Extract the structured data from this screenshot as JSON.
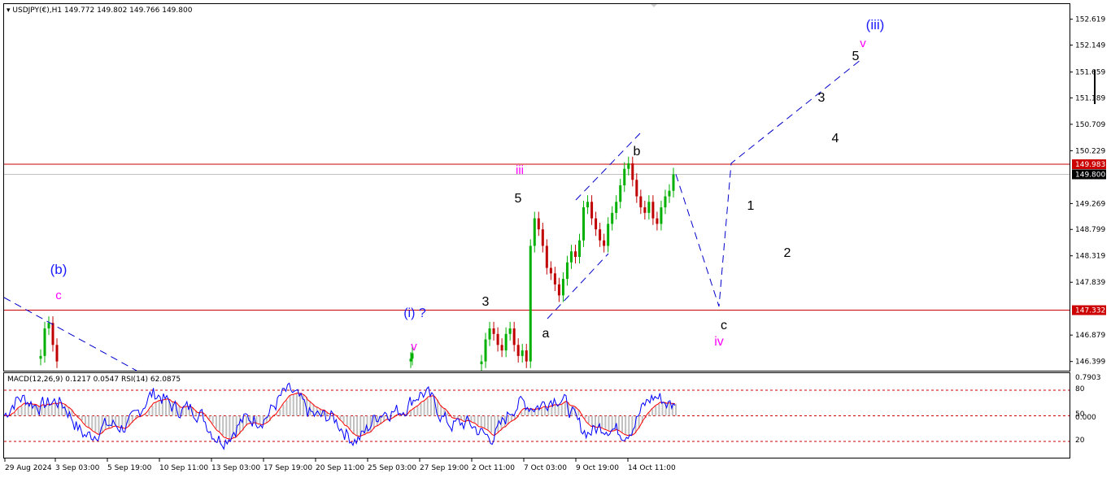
{
  "header": {
    "symbol": "USDJPY(€),H1",
    "ohlc": "149.772 149.802 149.766 149.800"
  },
  "indicator_header": {
    "macd": "MACD(12,26,9) 0.1217 0.0547",
    "rsi": "RSI(14) 62.0875"
  },
  "colors": {
    "up_candle": "#00b000",
    "down_candle": "#c00000",
    "level_line": "#cc0000",
    "wave_blue": "#1a1aff",
    "wave_magenta": "#ff00ff",
    "projection": "#0000cc",
    "price_line": "#c0c0c0",
    "macd_hist": "#c0c0c0",
    "rsi_line": "#0000ff",
    "signal_line": "#ff0000"
  },
  "chart_data": {
    "type": "candlestick",
    "symbol": "USDJPY",
    "timeframe": "H1",
    "y_ticks": [
      "152.619",
      "152.149",
      "151.659",
      "151.189",
      "150.709",
      "150.229",
      "149.269",
      "148.799",
      "148.319",
      "147.839",
      "146.879",
      "146.399"
    ],
    "ylim": [
      146.399,
      152.719
    ],
    "x_ticks": [
      "29 Aug 2024",
      "3 Sep 03:00",
      "5 Sep 19:00",
      "10 Sep 11:00",
      "13 Sep 03:00",
      "17 Sep 19:00",
      "20 Sep 11:00",
      "25 Sep 03:00",
      "27 Sep 19:00",
      "2 Oct 11:00",
      "7 Oct 03:00",
      "9 Oct 19:00",
      "14 Oct 11:00"
    ],
    "current_price": 149.8,
    "levels": [
      149.983,
      147.332
    ],
    "visible_segments": [
      {
        "from": "3 Sep 03:00",
        "to": "3 Sep 03:00",
        "prices": [
          146.5,
          147.0,
          147.1,
          146.7,
          146.4
        ]
      },
      {
        "from": "27 Sep 19:00",
        "to": "27 Sep 19:00",
        "prices": [
          146.45,
          146.55
        ]
      },
      {
        "from": "2 Oct 11:00",
        "to": "14 Oct 11:00",
        "prices": [
          146.4,
          146.8,
          147.0,
          146.9,
          146.7,
          146.6,
          146.9,
          147.0,
          146.7,
          146.5,
          146.6,
          146.4,
          148.5,
          149.0,
          148.8,
          148.5,
          148.1,
          148.0,
          147.8,
          147.6,
          147.9,
          148.2,
          148.4,
          148.3,
          148.6,
          149.2,
          149.3,
          149.0,
          148.8,
          148.6,
          148.5,
          148.9,
          149.1,
          149.3,
          149.6,
          149.9,
          150.0,
          149.7,
          149.4,
          149.2,
          149.1,
          149.3,
          149.0,
          148.9,
          149.2,
          149.4,
          149.5,
          149.8
        ]
      }
    ],
    "wave_labels": [
      {
        "text": "(b)",
        "color": "blue"
      },
      {
        "text": "c",
        "color": "magenta"
      },
      {
        "text": "(i) ?",
        "color": "blue"
      },
      {
        "text": "v",
        "color": "magenta"
      },
      {
        "text": "3",
        "color": "black"
      },
      {
        "text": "5",
        "color": "black"
      },
      {
        "text": "iii",
        "color": "magenta"
      },
      {
        "text": "a",
        "color": "black"
      },
      {
        "text": "b",
        "color": "black"
      },
      {
        "text": "c",
        "color": "black"
      },
      {
        "text": "iv",
        "color": "magenta"
      },
      {
        "text": "1",
        "color": "black"
      },
      {
        "text": "2",
        "color": "black"
      },
      {
        "text": "3",
        "color": "black"
      },
      {
        "text": "4",
        "color": "black"
      },
      {
        "text": "5",
        "color": "black"
      },
      {
        "text": "v",
        "color": "magenta"
      },
      {
        "text": "(iii)",
        "color": "blue"
      }
    ],
    "projection_path": [
      {
        "time": "14 Oct 11:00",
        "price": 149.8
      },
      {
        "time": "15 Oct",
        "price": 147.4
      },
      {
        "time": "16 Oct",
        "price": 150.0
      },
      {
        "time": "17 Oct",
        "price": 151.9
      }
    ],
    "indicator": {
      "name": "MACD(12,26,9) / RSI(14)",
      "y_ticks": [
        "0.7903",
        "80",
        "50",
        "0.000",
        "20"
      ],
      "levels": [
        80,
        50,
        20
      ],
      "rsi_last": 62.0875,
      "macd_last": 0.1217,
      "signal_last": 0.0547
    }
  }
}
